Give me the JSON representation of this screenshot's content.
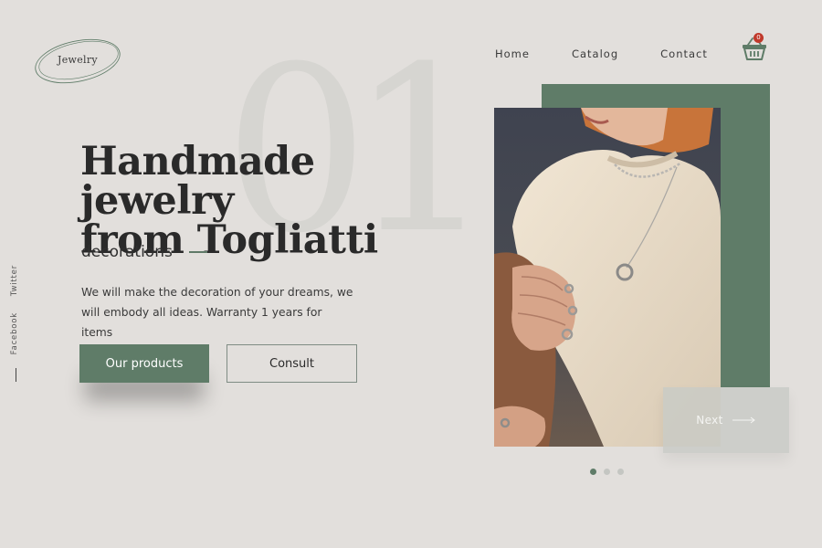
{
  "brand": {
    "logo_text": "Jewelry"
  },
  "nav": {
    "items": [
      "Home",
      "Catalog",
      "Contact"
    ]
  },
  "cart": {
    "count": "0",
    "icon": "basket-icon"
  },
  "hero": {
    "slide_number": "01",
    "headline_line1": "Handmade jewelry",
    "headline_line2": "from Togliatti",
    "subtitle": "decorations",
    "description": "We will make the decoration of your dreams, we will embody all ideas. Warranty 1 years for items",
    "primary_button": "Our products",
    "secondary_button": "Consult"
  },
  "social": {
    "links": [
      "Twitter",
      "Facebook"
    ]
  },
  "slider": {
    "next_label": "Next",
    "dots": 3,
    "active_dot": 1
  },
  "colors": {
    "background": "#e2dfdc",
    "accent": "#5f7c68",
    "badge": "#c0392b",
    "text": "#2a2a2a"
  }
}
